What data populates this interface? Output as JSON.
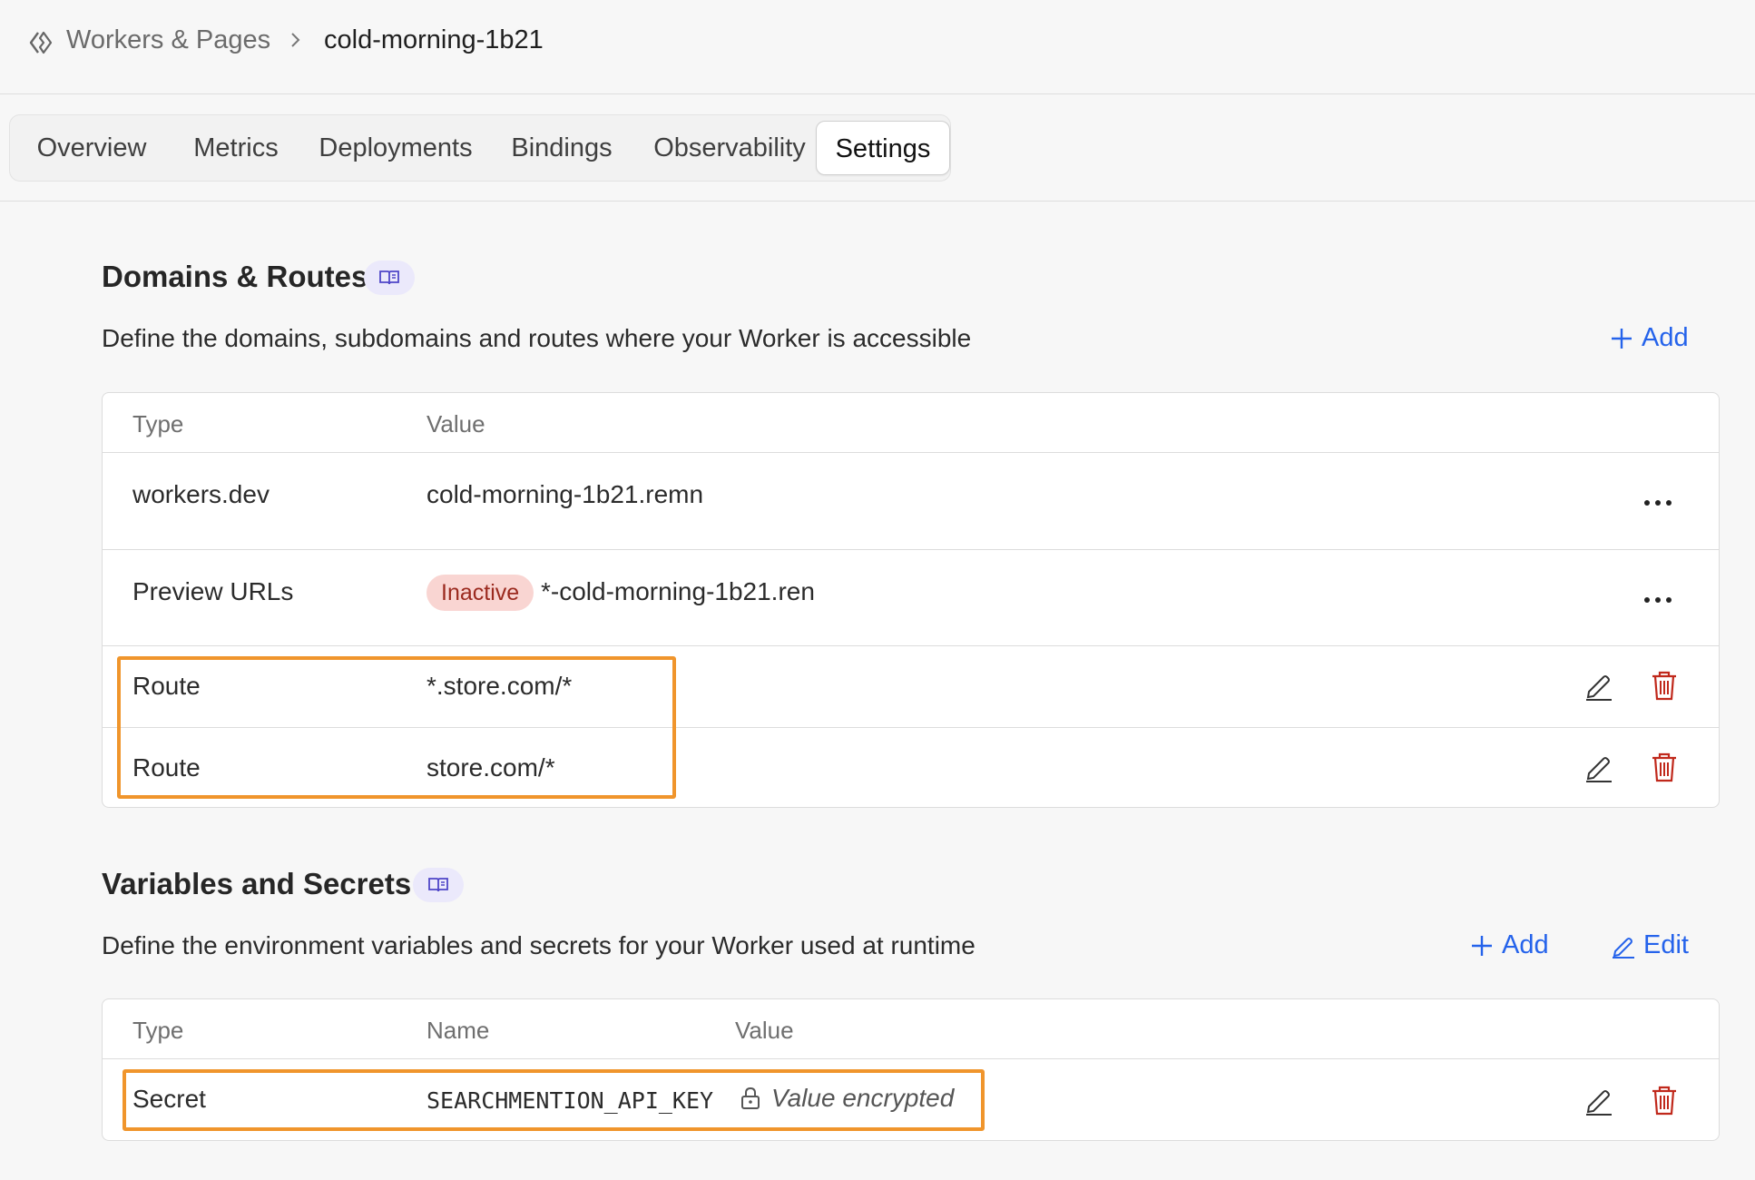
{
  "breadcrumb": {
    "parent": "Workers & Pages",
    "current": "cold-morning-1b21"
  },
  "tabs": [
    {
      "label": "Overview"
    },
    {
      "label": "Metrics"
    },
    {
      "label": "Deployments"
    },
    {
      "label": "Bindings"
    },
    {
      "label": "Observability"
    },
    {
      "label": "Settings",
      "active": true
    }
  ],
  "domains": {
    "title": "Domains & Routes",
    "description": "Define the domains, subdomains and routes where your Worker is accessible",
    "add_label": "Add",
    "columns": [
      "Type",
      "Value"
    ],
    "rows": [
      {
        "type": "workers.dev",
        "value": "cold-morning-1b21.remn"
      },
      {
        "type": "Preview URLs",
        "status": "Inactive",
        "value": "*-cold-morning-1b21.ren"
      },
      {
        "type": "Route",
        "value": "*.store.com/*"
      },
      {
        "type": "Route",
        "value": "store.com/*"
      }
    ]
  },
  "variables": {
    "title": "Variables and Secrets",
    "description": "Define the environment variables and secrets for your Worker used at runtime",
    "add_label": "Add",
    "edit_label": "Edit",
    "columns": [
      "Type",
      "Name",
      "Value"
    ],
    "rows": [
      {
        "type": "Secret",
        "name": "SEARCHMENTION_API_KEY",
        "value": "Value encrypted"
      }
    ]
  },
  "colors": {
    "link": "#2563eb",
    "danger": "#c0281b",
    "highlight": "#f0952c",
    "inactive_badge_bg": "#f9d5d2"
  }
}
